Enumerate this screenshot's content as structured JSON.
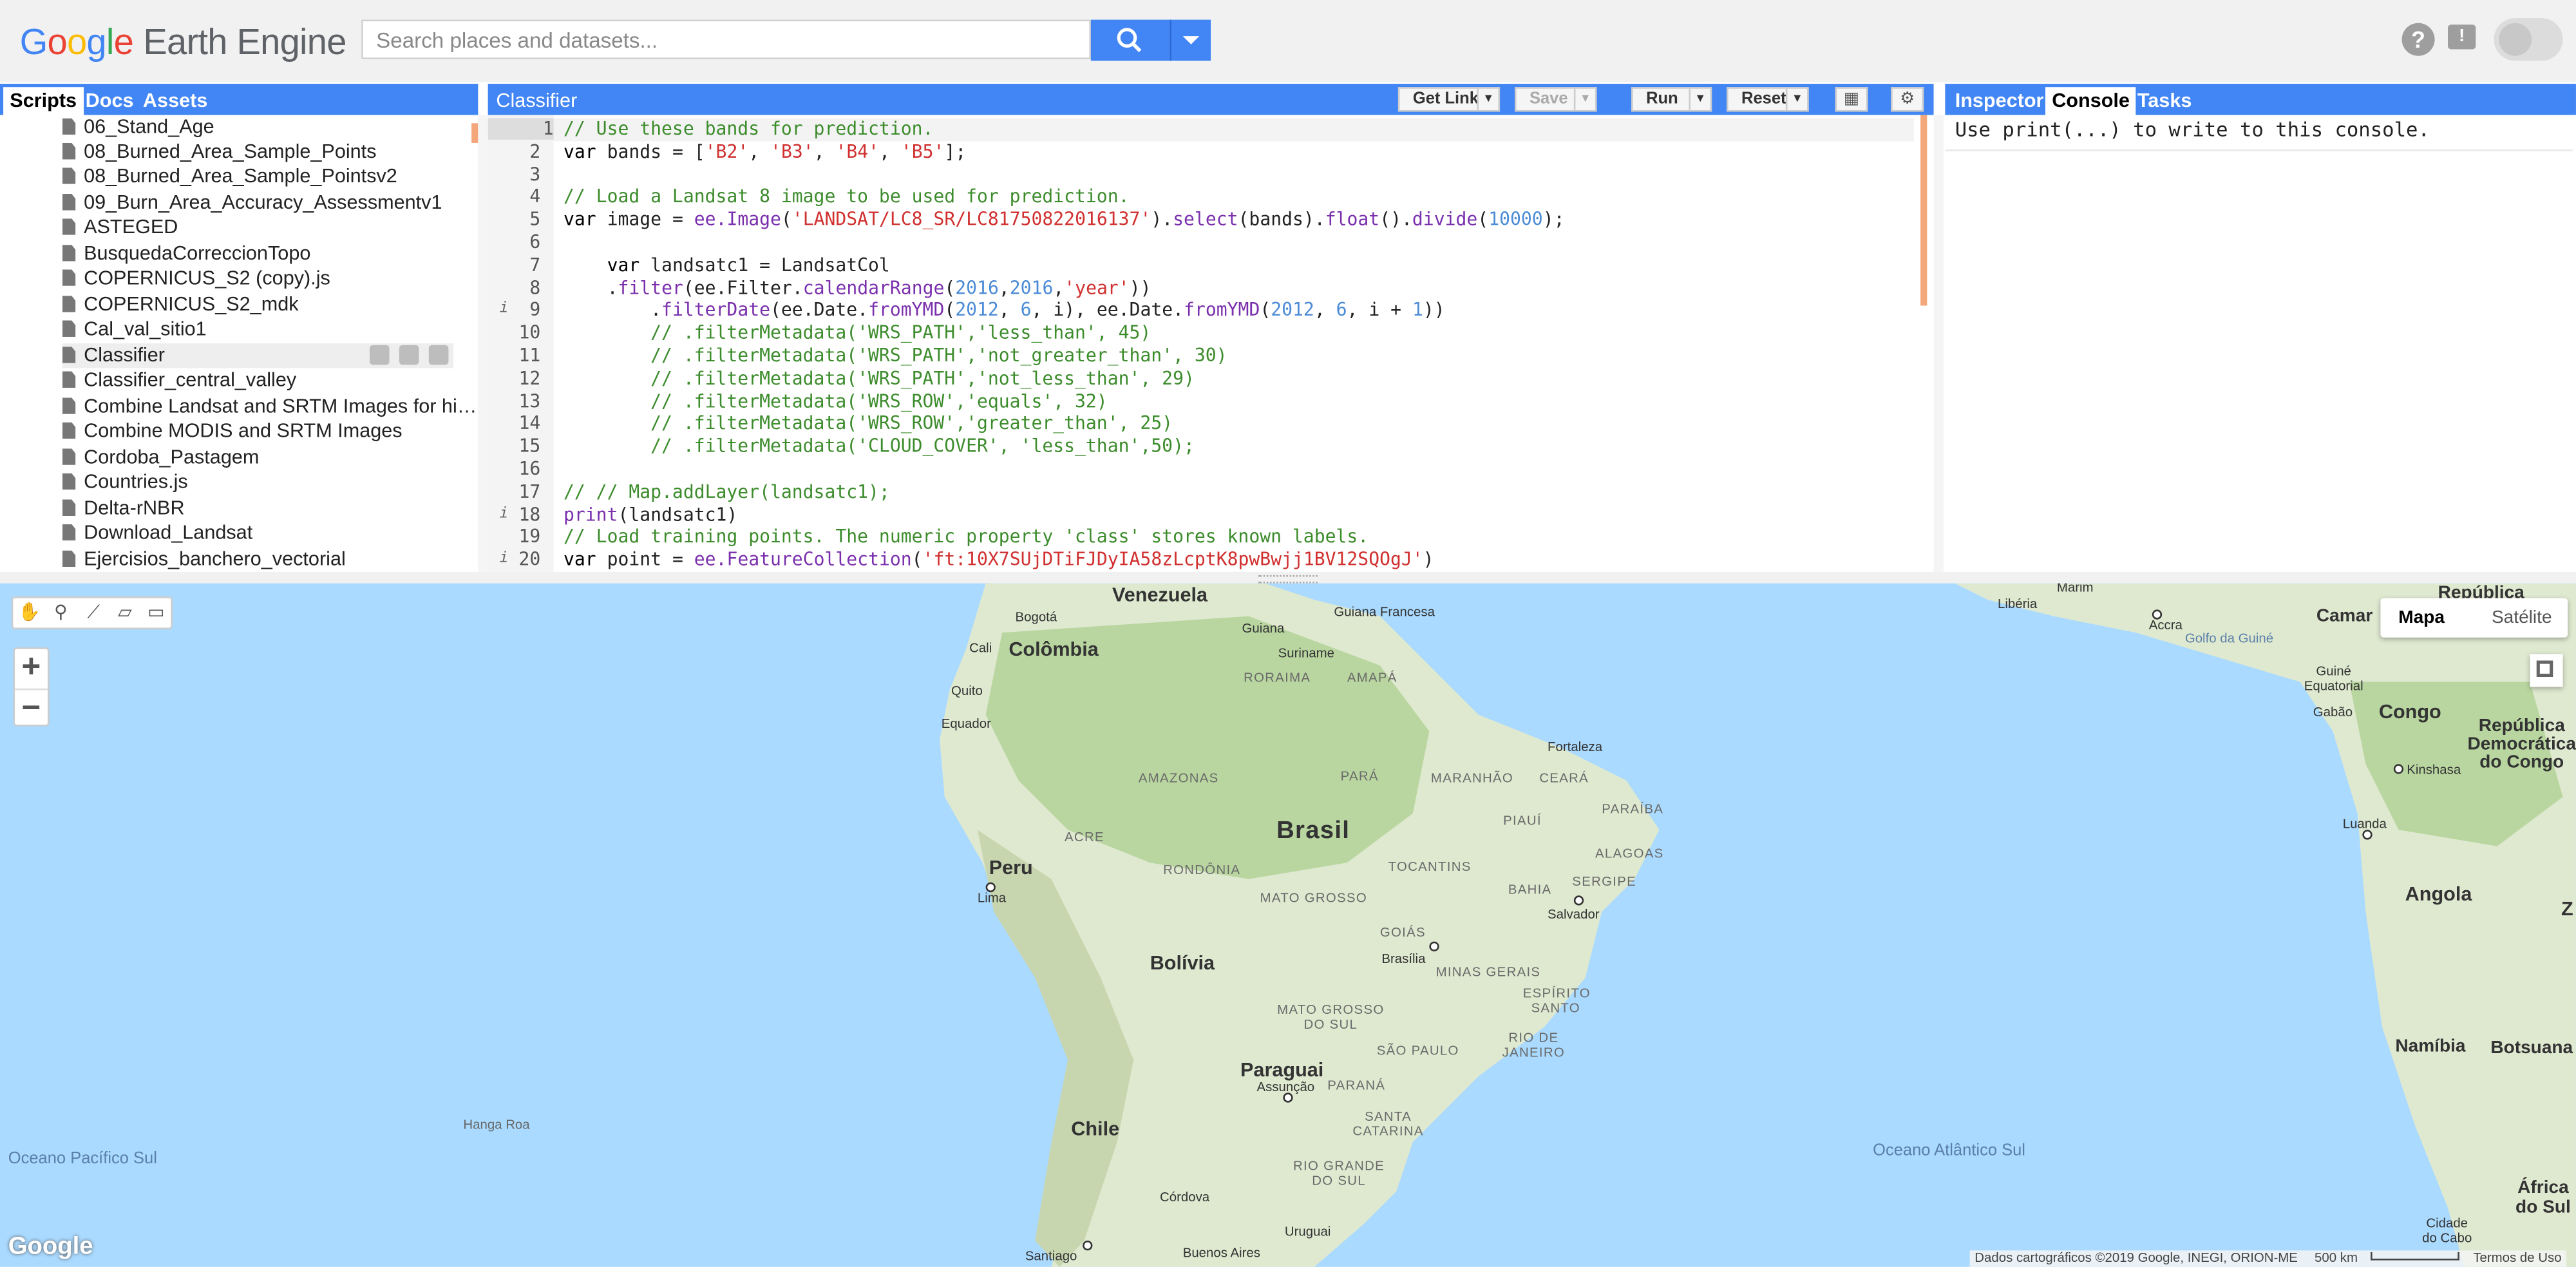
{
  "header": {
    "logo_google": [
      "G",
      "o",
      "o",
      "g",
      "l",
      "e"
    ],
    "logo_suffix": "Earth Engine",
    "search_placeholder": "Search places and datasets...",
    "help_symbol": "?",
    "feedback_symbol": "!"
  },
  "left_panel": {
    "tabs": [
      "Scripts",
      "Docs",
      "Assets"
    ],
    "active_tab": "Scripts",
    "files": [
      "06_Stand_Age",
      "08_Burned_Area_Sample_Points",
      "08_Burned_Area_Sample_Pointsv2",
      "09_Burn_Area_Accuracy_Assessmentv1",
      "ASTEGED",
      "BusquedaCorreccionTopo",
      "COPERNICUS_S2 (copy).js",
      "COPERNICUS_S2_mdk",
      "Cal_val_sitio1",
      "Classifier",
      "Classifier_central_valley",
      "Combine Landsat and SRTM Images for hi…",
      "Combine MODIS and SRTM Images",
      "Cordoba_Pastagem",
      "Countries.js",
      "Delta-rNBR",
      "Download_Landsat",
      "Ejercisios_banchero_vectorial"
    ],
    "selected_file": "Classifier"
  },
  "editor": {
    "title": "Classifier",
    "buttons": {
      "get_link": "Get Link",
      "save": "Save",
      "run": "Run",
      "reset": "Reset"
    },
    "line_numbers": [
      "1",
      "2",
      "3",
      "4",
      "5",
      "6",
      "7",
      "8",
      "9",
      "10",
      "11",
      "12",
      "13",
      "14",
      "15",
      "16",
      "17",
      "18",
      "19",
      "20"
    ],
    "info_lines": [
      "9",
      "18",
      "20"
    ],
    "lines": [
      [
        {
          "t": "// Use these bands for prediction.",
          "c": "cm"
        }
      ],
      [
        {
          "t": "var",
          "c": "kw"
        },
        {
          "t": " bands = [",
          "c": ""
        },
        {
          "t": "'B2'",
          "c": "st"
        },
        {
          "t": ", ",
          "c": ""
        },
        {
          "t": "'B3'",
          "c": "st"
        },
        {
          "t": ", ",
          "c": ""
        },
        {
          "t": "'B4'",
          "c": "st"
        },
        {
          "t": ", ",
          "c": ""
        },
        {
          "t": "'B5'",
          "c": "st"
        },
        {
          "t": "];",
          "c": ""
        }
      ],
      [],
      [
        {
          "t": "// Load a Landsat 8 image to be used for prediction.",
          "c": "cm"
        }
      ],
      [
        {
          "t": "var",
          "c": "kw"
        },
        {
          "t": " image = ",
          "c": ""
        },
        {
          "t": "ee.Image",
          "c": "fn"
        },
        {
          "t": "(",
          "c": ""
        },
        {
          "t": "'LANDSAT/LC8_SR/LC81750822016137'",
          "c": "st"
        },
        {
          "t": ").",
          "c": ""
        },
        {
          "t": "select",
          "c": "me"
        },
        {
          "t": "(bands).",
          "c": ""
        },
        {
          "t": "float",
          "c": "me"
        },
        {
          "t": "().",
          "c": ""
        },
        {
          "t": "divide",
          "c": "me"
        },
        {
          "t": "(",
          "c": ""
        },
        {
          "t": "10000",
          "c": "nu"
        },
        {
          "t": ");",
          "c": ""
        }
      ],
      [],
      [
        {
          "t": "    var",
          "c": "kw"
        },
        {
          "t": " landsatc1 = LandsatCol",
          "c": ""
        }
      ],
      [
        {
          "t": "    .",
          "c": ""
        },
        {
          "t": "filter",
          "c": "me"
        },
        {
          "t": "(ee.Filter.",
          "c": ""
        },
        {
          "t": "calendarRange",
          "c": "me"
        },
        {
          "t": "(",
          "c": ""
        },
        {
          "t": "2016",
          "c": "nu"
        },
        {
          "t": ",",
          "c": ""
        },
        {
          "t": "2016",
          "c": "nu"
        },
        {
          "t": ",",
          "c": ""
        },
        {
          "t": "'year'",
          "c": "st"
        },
        {
          "t": "))",
          "c": ""
        }
      ],
      [
        {
          "t": "        .",
          "c": ""
        },
        {
          "t": "filterDate",
          "c": "me"
        },
        {
          "t": "(ee.Date.",
          "c": ""
        },
        {
          "t": "fromYMD",
          "c": "me"
        },
        {
          "t": "(",
          "c": ""
        },
        {
          "t": "2012",
          "c": "nu"
        },
        {
          "t": ", ",
          "c": ""
        },
        {
          "t": "6",
          "c": "nu"
        },
        {
          "t": ", i), ee.Date.",
          "c": ""
        },
        {
          "t": "fromYMD",
          "c": "me"
        },
        {
          "t": "(",
          "c": ""
        },
        {
          "t": "2012",
          "c": "nu"
        },
        {
          "t": ", ",
          "c": ""
        },
        {
          "t": "6",
          "c": "nu"
        },
        {
          "t": ", i + ",
          "c": ""
        },
        {
          "t": "1",
          "c": "nu"
        },
        {
          "t": "))",
          "c": ""
        }
      ],
      [
        {
          "t": "        // .filterMetadata('WRS_PATH','less_than', 45)",
          "c": "cm"
        }
      ],
      [
        {
          "t": "        // .filterMetadata('WRS_PATH','not_greater_than', 30)",
          "c": "cm"
        }
      ],
      [
        {
          "t": "        // .filterMetadata('WRS_PATH','not_less_than', 29)",
          "c": "cm"
        }
      ],
      [
        {
          "t": "        // .filterMetadata('WRS_ROW','equals', 32)",
          "c": "cm"
        }
      ],
      [
        {
          "t": "        // .filterMetadata('WRS_ROW','greater_than', 25)",
          "c": "cm"
        }
      ],
      [
        {
          "t": "        // .filterMetadata('CLOUD_COVER', 'less_than',50);",
          "c": "cm"
        }
      ],
      [],
      [
        {
          "t": "// // Map.addLayer(landsatc1);",
          "c": "cm"
        }
      ],
      [
        {
          "t": "print",
          "c": "me"
        },
        {
          "t": "(landsatc1)",
          "c": ""
        }
      ],
      [
        {
          "t": "// Load training points. The numeric property 'class' stores known labels.",
          "c": "cm"
        }
      ],
      [
        {
          "t": "var",
          "c": "kw"
        },
        {
          "t": " point = ",
          "c": ""
        },
        {
          "t": "ee.FeatureCollection",
          "c": "fn"
        },
        {
          "t": "(",
          "c": ""
        },
        {
          "t": "'ft:10X7SUjDTiFJDyIA58zLcptK8pwBwjj1BV12SQOgJ'",
          "c": "st"
        },
        {
          "t": ")",
          "c": ""
        }
      ]
    ],
    "colors": {
      "cm": "#3c8c2c",
      "kw": "#000000",
      "st": "#d0302f",
      "fn": "#7a2fad",
      "me": "#7a2fad",
      "nu": "#4b8bd6"
    }
  },
  "right_panel": {
    "tabs": [
      "Inspector",
      "Console",
      "Tasks"
    ],
    "active_tab": "Console",
    "console_message": "Use print(...) to write to this console."
  },
  "map": {
    "map_type_buttons": [
      "Mapa",
      "Satélite"
    ],
    "active_map_type": "Mapa",
    "zoom_in": "+",
    "zoom_out": "−",
    "google_logo": "Google",
    "attribution": "Dados cartográficos ©2019 Google, INEGI, ORION-ME",
    "scale": "500 km",
    "terms": "Termos de Uso",
    "labels": {
      "venezuela": "Venezuela",
      "guiana": "Guiana",
      "guiana_francesa": "Guiana Francesa",
      "suriname": "Suriname",
      "colombia": "Colômbia",
      "bogota": "Bogotá",
      "cali": "Cali",
      "quito": "Quito",
      "equador": "Equador",
      "peru": "Peru",
      "lima": "Lima",
      "bolivia": "Bolívia",
      "brasil": "Brasil",
      "paraguai": "Paraguai",
      "assuncao": "Assunção",
      "chile": "Chile",
      "uruguai": "Uruguai",
      "cordova": "Córdova",
      "santiago": "Santiago",
      "buenos_aires": "Buenos Aires",
      "brasilia": "Brasília",
      "salvador": "Salvador",
      "fortaleza": "Fortaleza",
      "roraima": "RORAIMA",
      "amapa": "AMAPÁ",
      "amazonas": "AMAZONAS",
      "para": "PARÁ",
      "maranhao": "MARANHÃO",
      "ceara": "CEARÁ",
      "paraiba": "PARAÍBA",
      "alagoas": "ALAGOAS",
      "sergipe": "SERGIPE",
      "piaui": "PIAUÍ",
      "acre": "ACRE",
      "rondonia": "RONDÔNIA",
      "tocantins": "TOCANTINS",
      "bahia": "BAHIA",
      "mato_grosso": "MATO GROSSO",
      "goias": "GOIÁS",
      "minas": "MINAS GERAIS",
      "espirito": "ESPÍRITO SANTO",
      "mgs": "MATO GROSSO DO SUL",
      "sao_paulo": "SÃO PAULO",
      "rio": "RIO DE JANEIRO",
      "parana": "PARANÁ",
      "santa_catarina": "SANTA CATARINA",
      "rio_grande": "RIO GRANDE DO SUL",
      "hanga_roa": "Hanga Roa",
      "oceano_pacifico": "Oceano Pacífico Sul",
      "oceano_atlantico": "Oceano Atlântico Sul",
      "liberia": "Libéria",
      "marim": "Marim",
      "accra": "Accra",
      "republica": "República",
      "camaroes": "Camar",
      "golfo": "Golfo da Guiné",
      "guine_equatorial": "Guiné Equatorial",
      "gabao": "Gabão",
      "congo": "Congo",
      "rdc": "República Democrática do Congo",
      "kinshasa": "Kinshasa",
      "luanda": "Luanda",
      "angola": "Angola",
      "namibia": "Namíbia",
      "botsuana": "Botsuana",
      "africa_sul": "África do Sul",
      "cidade_cabo": "Cidade do Cabo",
      "z": "Z"
    }
  }
}
